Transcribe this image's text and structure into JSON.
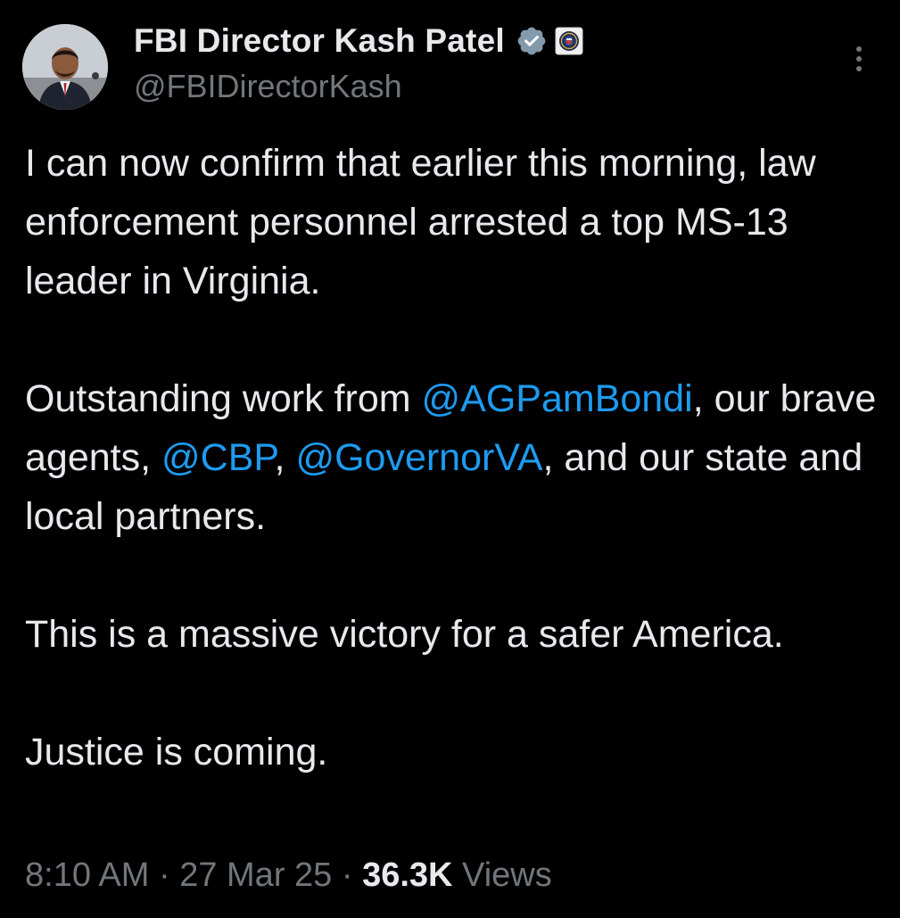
{
  "author": {
    "display_name": "FBI Director Kash Patel",
    "handle": "@FBIDirectorKash",
    "avatar_icon": "avatar-photo",
    "verified_icon": "verified-badge-icon",
    "affiliate_icon": "fbi-seal-icon"
  },
  "more_icon": "more-vertical-icon",
  "body": {
    "p1": "I can now confirm that earlier this morning, law enforcement personnel arrested a top MS-13 leader in Virginia.",
    "p2_start": "Outstanding work from ",
    "mention_1": "@AGPamBondi",
    "p2_sep1": ", our brave agents, ",
    "mention_2": "@CBP",
    "p2_sep2": ", ",
    "mention_3": "@GovernorVA",
    "p2_end": ", and our state and local partners.",
    "p3": "This is a massive victory for a safer America.",
    "p4": "Justice is coming."
  },
  "meta": {
    "time": "8:10 AM",
    "separator": " · ",
    "date": "27 Mar 25",
    "views_count": "36.3K",
    "views_label": "Views"
  },
  "colors": {
    "background": "#000000",
    "text": "#e7e9ea",
    "secondary": "#71767b",
    "link": "#1d9bf0",
    "verified": "#829aab"
  }
}
